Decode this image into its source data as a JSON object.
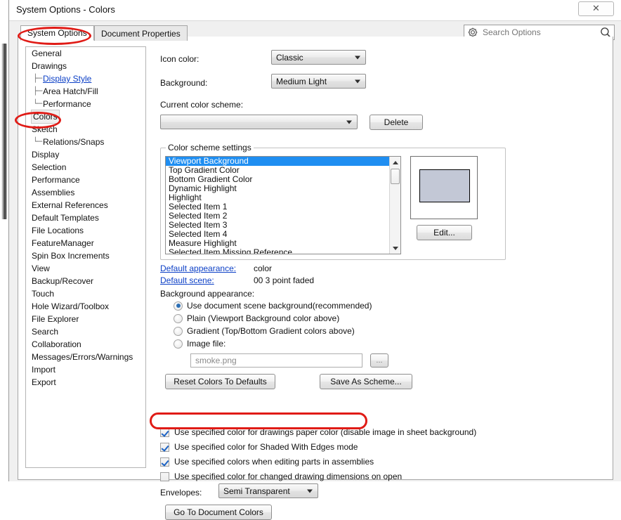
{
  "window": {
    "title": "System Options - Colors",
    "close_label": "✕"
  },
  "tabs": [
    {
      "label": "System Options",
      "active": true
    },
    {
      "label": "Document Properties",
      "active": false
    }
  ],
  "search": {
    "placeholder": "Search Options",
    "value": "",
    "gear_icon": "gear-icon",
    "magnifier_icon": "search-icon"
  },
  "sidebar": {
    "items": [
      {
        "label": "General",
        "level": 0,
        "link": false,
        "selected": false
      },
      {
        "label": "Drawings",
        "level": 0,
        "link": false,
        "selected": false
      },
      {
        "label": "Display Style",
        "level": 1,
        "link": true,
        "selected": false
      },
      {
        "label": "Area Hatch/Fill",
        "level": 1,
        "link": false,
        "selected": false
      },
      {
        "label": "Performance",
        "level": 1,
        "link": false,
        "selected": false
      },
      {
        "label": "Colors",
        "level": 0,
        "link": false,
        "selected": true
      },
      {
        "label": "Sketch",
        "level": 0,
        "link": false,
        "selected": false
      },
      {
        "label": "Relations/Snaps",
        "level": 1,
        "link": false,
        "selected": false
      },
      {
        "label": "Display",
        "level": 0,
        "link": false,
        "selected": false
      },
      {
        "label": "Selection",
        "level": 0,
        "link": false,
        "selected": false
      },
      {
        "label": "Performance",
        "level": 0,
        "link": false,
        "selected": false
      },
      {
        "label": "Assemblies",
        "level": 0,
        "link": false,
        "selected": false
      },
      {
        "label": "External References",
        "level": 0,
        "link": false,
        "selected": false
      },
      {
        "label": "Default Templates",
        "level": 0,
        "link": false,
        "selected": false
      },
      {
        "label": "File Locations",
        "level": 0,
        "link": false,
        "selected": false
      },
      {
        "label": "FeatureManager",
        "level": 0,
        "link": false,
        "selected": false
      },
      {
        "label": "Spin Box Increments",
        "level": 0,
        "link": false,
        "selected": false
      },
      {
        "label": "View",
        "level": 0,
        "link": false,
        "selected": false
      },
      {
        "label": "Backup/Recover",
        "level": 0,
        "link": false,
        "selected": false
      },
      {
        "label": "Touch",
        "level": 0,
        "link": false,
        "selected": false
      },
      {
        "label": "Hole Wizard/Toolbox",
        "level": 0,
        "link": false,
        "selected": false
      },
      {
        "label": "File Explorer",
        "level": 0,
        "link": false,
        "selected": false
      },
      {
        "label": "Search",
        "level": 0,
        "link": false,
        "selected": false
      },
      {
        "label": "Collaboration",
        "level": 0,
        "link": false,
        "selected": false
      },
      {
        "label": "Messages/Errors/Warnings",
        "level": 0,
        "link": false,
        "selected": false
      },
      {
        "label": "Import",
        "level": 0,
        "link": false,
        "selected": false
      },
      {
        "label": "Export",
        "level": 0,
        "link": false,
        "selected": false
      }
    ]
  },
  "pane": {
    "icon_color": {
      "label": "Icon color:",
      "value": "Classic"
    },
    "background": {
      "label": "Background:",
      "value": "Medium Light"
    },
    "current_color_scheme": {
      "label": "Current color scheme:",
      "value": ""
    },
    "delete_button": "Delete",
    "group": {
      "legend": "Color scheme settings",
      "items": [
        "Viewport Background",
        "Top Gradient Color",
        "Bottom Gradient Color",
        "Dynamic Highlight",
        "Highlight",
        "Selected Item 1",
        "Selected Item 2",
        "Selected Item 3",
        "Selected Item 4",
        "Measure Highlight",
        "Selected Item Missing Reference"
      ],
      "selected_index": 0,
      "preview_swatch_color": "#c3c8d6",
      "edit_button": "Edit..."
    },
    "default_appearance": {
      "label": "Default appearance:",
      "value": "color"
    },
    "default_scene": {
      "label": "Default scene:",
      "value": "00 3 point faded"
    },
    "background_appearance": {
      "label": "Background appearance:",
      "options": [
        {
          "label": "Use document scene background(recommended)",
          "selected": true
        },
        {
          "label": "Plain (Viewport Background color above)",
          "selected": false
        },
        {
          "label": "Gradient (Top/Bottom Gradient colors above)",
          "selected": false
        },
        {
          "label": "Image file:",
          "selected": false
        }
      ],
      "image_file_value": "smoke.png",
      "browse_button": "..."
    },
    "reset_button": "Reset Colors To Defaults",
    "save_scheme_button": "Save As Scheme...",
    "checkboxes": [
      {
        "label": "Use specified color for drawings paper color (disable image in sheet background)",
        "checked": true
      },
      {
        "label": "Use specified color for Shaded With Edges mode",
        "checked": true
      },
      {
        "label": "Use specified colors when editing parts in assemblies",
        "checked": true
      },
      {
        "label": "Use specified color for changed drawing dimensions on open",
        "checked": false
      }
    ],
    "envelopes": {
      "label": "Envelopes:",
      "value": "Semi Transparent"
    },
    "go_to_document_colors_button": "Go To Document Colors"
  },
  "annotations": {
    "accent_color": "#e01b16",
    "highlights": [
      "system-options-tab",
      "sidebar-colors-item",
      "checkbox-use-specified-colors-assemblies"
    ]
  }
}
